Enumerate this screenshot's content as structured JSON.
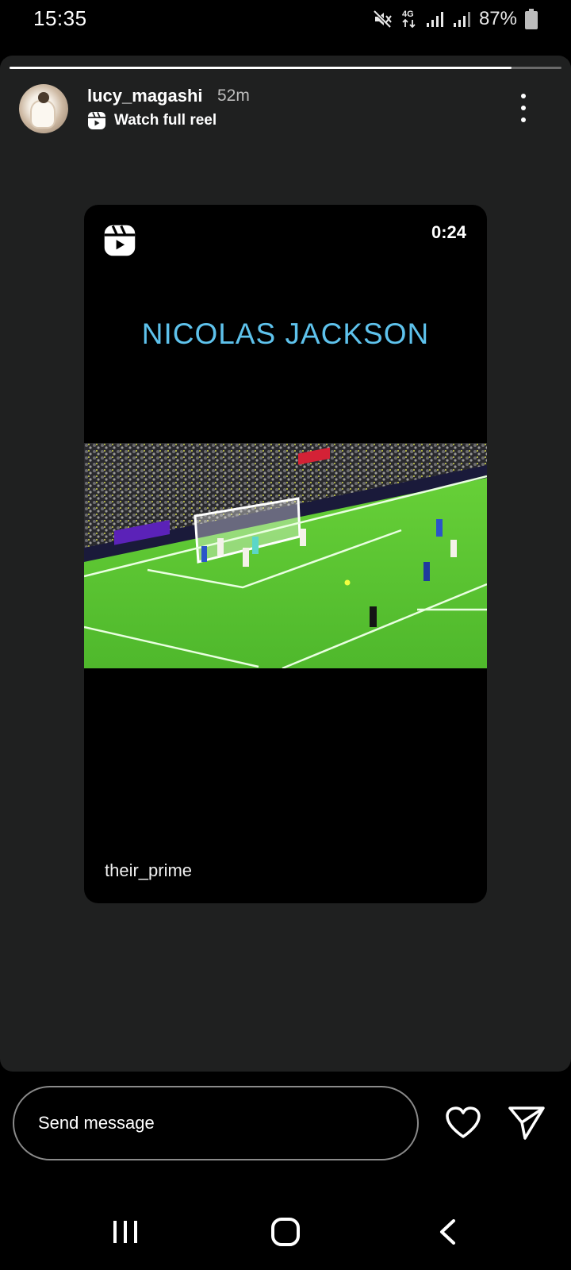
{
  "status_bar": {
    "time": "15:35",
    "network": "4G",
    "battery": "87%",
    "icons": [
      "mute-icon",
      "4g-icon",
      "signal-icon",
      "signal-icon",
      "battery-icon"
    ]
  },
  "story": {
    "progress": 0.91,
    "username": "lucy_magashi",
    "time_ago": "52m",
    "watch_label": "Watch full reel"
  },
  "reel": {
    "duration": "0:24",
    "title": "NICOLAS JACKSON",
    "creator": "their_prime",
    "title_color": "#5ec2ec"
  },
  "message": {
    "placeholder": "Send message"
  },
  "colors": {
    "card_bg": "#1f2020",
    "pitch_green": "#5fc734"
  }
}
